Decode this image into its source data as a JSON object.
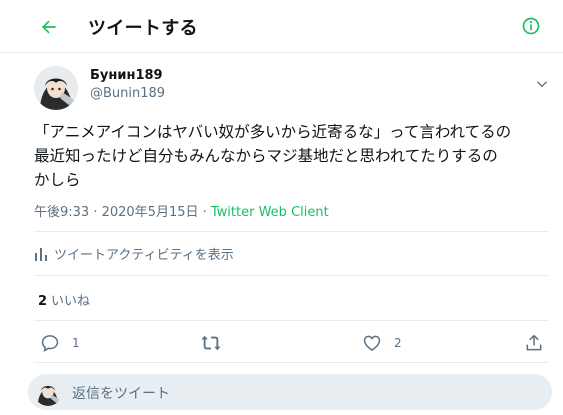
{
  "header": {
    "title": "ツイートする"
  },
  "author": {
    "name": "Бунин189",
    "handle": "@Bunin189"
  },
  "tweet": {
    "text": "「アニメアイコンはヤバい奴が多いから近寄るな」って言われてるの\n最近知ったけど自分もみんなからマジ基地だと思われてたりするの\nかしら",
    "time": "午後9:33 · 2020年5月15日 · ",
    "client": "Twitter Web Client"
  },
  "activity": {
    "label": "ツイートアクティビティを表示"
  },
  "stats": {
    "likes_count": "2",
    "likes_label": "いいね"
  },
  "actions": {
    "reply_count": "1",
    "like_count": "2"
  },
  "reply": {
    "placeholder": "返信をツイート"
  },
  "colors": {
    "accent": "#17bf63",
    "secondary_text": "#5b7083",
    "divider": "#e6ecf0"
  },
  "icons": [
    "back-arrow-icon",
    "info-icon",
    "chevron-down-icon",
    "bar-chart-icon",
    "reply-icon",
    "retweet-icon",
    "like-icon",
    "share-icon"
  ]
}
